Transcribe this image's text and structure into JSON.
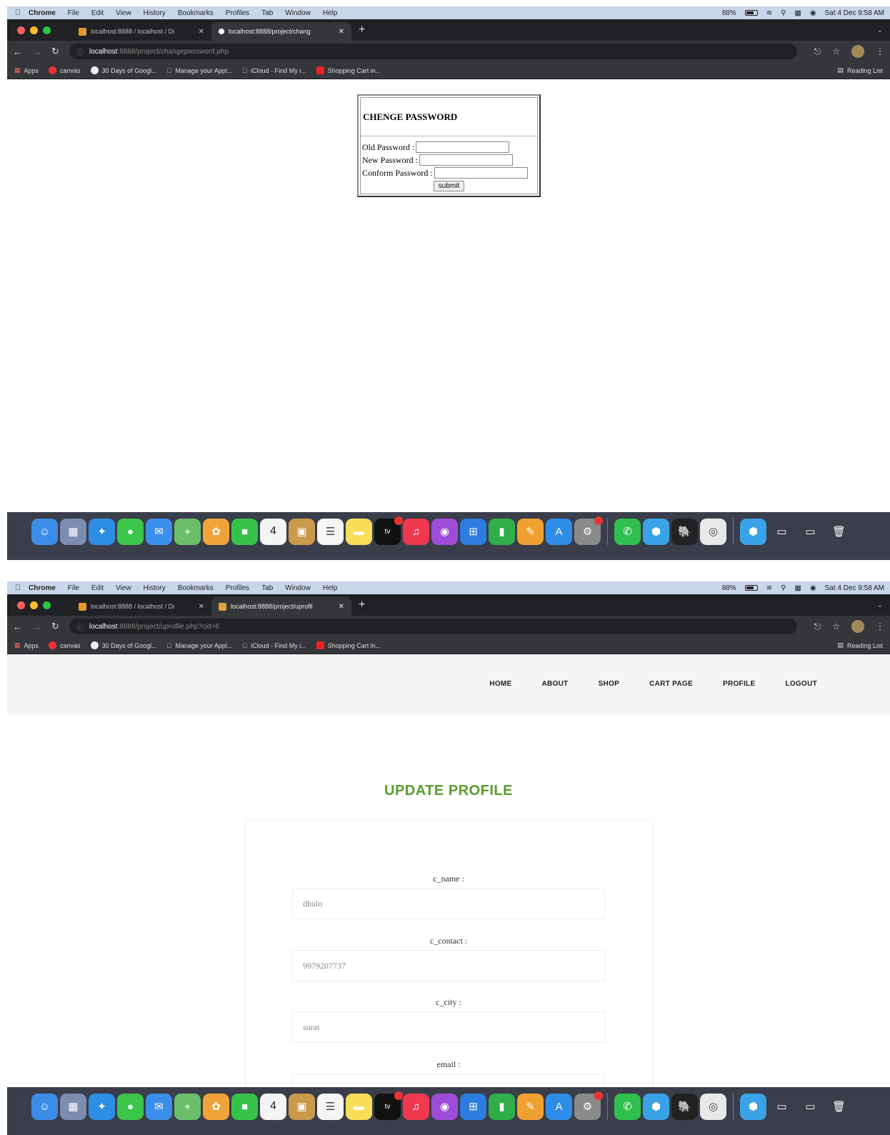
{
  "menubar": {
    "app": "Chrome",
    "items": [
      "File",
      "Edit",
      "View",
      "History",
      "Bookmarks",
      "Profiles",
      "Tab",
      "Window",
      "Help"
    ],
    "battery": "88%",
    "datetime": "Sat 4 Dec 9:58 AM"
  },
  "bookmarks": {
    "apps": "Apps",
    "canvas": "canvas",
    "google": "30 Days of Googl...",
    "apple": "Manage your Appl...",
    "icloud": "iCloud - Find My i...",
    "cart": "Shopping Cart in...",
    "reading": "Reading List"
  },
  "shot1": {
    "tabs": [
      {
        "label": "localhost:8888 / localhost / Di"
      },
      {
        "label": "localhost:8888/project/chang"
      }
    ],
    "url_host": "localhost",
    "url_path": ":8888/project/changepassword.php",
    "form": {
      "title": "CHENGE PASSWORD",
      "old_label": "Old Password :",
      "new_label": "New Password :",
      "confirm_label": "Conform Password :",
      "submit": "submit"
    }
  },
  "shot2": {
    "tabs": [
      {
        "label": "localhost:8888 / localhost / Di"
      },
      {
        "label": "localhost:8888/project/uprofil"
      }
    ],
    "url_host": "localhost",
    "url_path": ":8888/project/uprofile.php?cid=6",
    "nav": [
      "HOME",
      "ABOUT",
      "SHOP",
      "CART PAGE",
      "PROFILE",
      "LOGOUT"
    ],
    "heading": "UPDATE PROFILE",
    "fields": [
      {
        "label": "c_name :",
        "value": "dhulo"
      },
      {
        "label": "c_contact :",
        "value": "9979207737"
      },
      {
        "label": "c_city :",
        "value": "surat"
      },
      {
        "label": "email :",
        "value": ""
      }
    ]
  },
  "dock": {
    "calendar_day": "4",
    "tv_label": "tv",
    "icons": [
      "finder-icon",
      "launchpad-icon",
      "safari-icon",
      "messages-icon",
      "mail-icon",
      "maps-icon",
      "photos-icon",
      "facetime-icon",
      "calendar-icon",
      "contacts-icon",
      "reminders-icon",
      "notes-icon",
      "appletv-icon",
      "music-icon",
      "podcasts-icon",
      "keynote-icon",
      "numbers-icon",
      "pages-icon",
      "appstore-icon",
      "system-preferences-icon",
      "whatsapp-icon",
      "box-icon",
      "mamp-icon",
      "chrome-icon",
      "box2-icon",
      "window-icon",
      "window2-icon",
      "trash-icon"
    ],
    "colors": {
      "finder": "#3d8ce8",
      "launchpad": "#7c8db0",
      "safari": "#2e8ee6",
      "messages": "#3bc64a",
      "mail": "#3a8fea",
      "maps": "#6bbf6a",
      "photos": "#f0a33b",
      "facetime": "#36c24a",
      "calendar": "#f4f4f4",
      "contacts": "#c89a4a",
      "reminders": "#f5f5f5",
      "notes": "#f8dd5a",
      "appletv": "#111111",
      "music": "#f0394f",
      "podcasts": "#9d4dd8",
      "keynote": "#2d7de0",
      "numbers": "#2fae4a",
      "pages": "#f0a030",
      "appstore": "#2f8de8",
      "sysprefs": "#8a8a8a",
      "whatsapp": "#2fbf4e",
      "box": "#3aa3e8",
      "mamp": "#222222",
      "chrome": "#e8e8e8",
      "trash": "#9a9a9a"
    }
  }
}
